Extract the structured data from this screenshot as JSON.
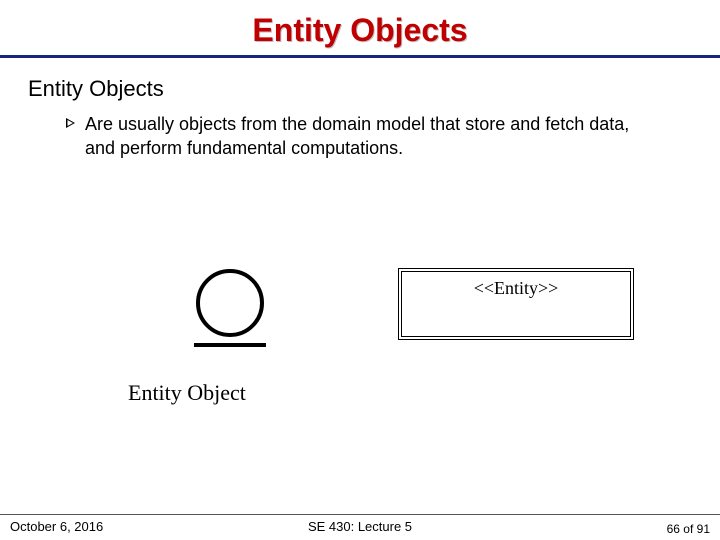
{
  "title": "Entity Objects",
  "subhead": "Entity Objects",
  "bullet": "Are usually objects from the domain model that store and fetch data, and perform fundamental computations.",
  "entity_caption": "Entity Object",
  "stereotype_label": "<<Entity>>",
  "footer": {
    "date": "October 6, 2016",
    "course": "SE 430: Lecture 5",
    "page": "66 of 91"
  }
}
